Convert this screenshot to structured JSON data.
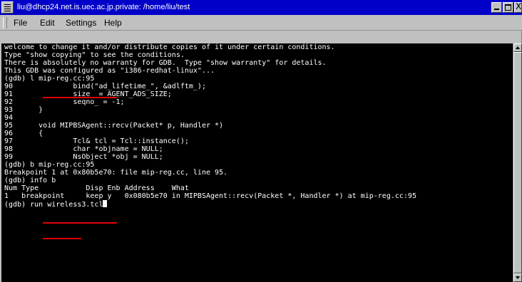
{
  "window": {
    "title": "liu@dhcp24.net.is.uec.ac.jp.private: /home/liu/test",
    "close_glyph": "X"
  },
  "menubar": {
    "items": [
      "File",
      "Edit",
      "Settings",
      "Help"
    ]
  },
  "terminal": {
    "lines": [
      "welcome to change it and/or distribute copies of it under certain conditions.",
      "Type \"show copying\" to see the conditions.",
      "There is absolutely no warranty for GDB.  Type \"show warranty\" for details.",
      "This GDB was configured as \"i386-redhat-linux\"...",
      "(gdb) l mip-reg.cc:95",
      "90              bind(\"ad_lifetime_\", &adlftm_);",
      "91              size_ = AGENT_ADS_SIZE;",
      "92              seqno_ = -1;",
      "93      }",
      "94",
      "95      void MIPBSAgent::recv(Packet* p, Handler *)",
      "96      {",
      "97              Tcl& tcl = Tcl::instance();",
      "98              char *objname = NULL;",
      "99              NsObject *obj = NULL;",
      "(gdb) b mip-reg.cc:95",
      "Breakpoint 1 at 0x80b5e70: file mip-reg.cc, line 95.",
      "(gdb) info b",
      "Num Type           Disp Enb Address    What",
      "1   breakpoint     keep y   0x080b5e70 in MIPBSAgent::recv(Packet *, Handler *) at mip-reg.cc:95",
      "(gdb) run wireless3.tcl"
    ],
    "foreground_color": "#ffffff",
    "background_color": "#000000",
    "annotation_color": "#e00000"
  }
}
